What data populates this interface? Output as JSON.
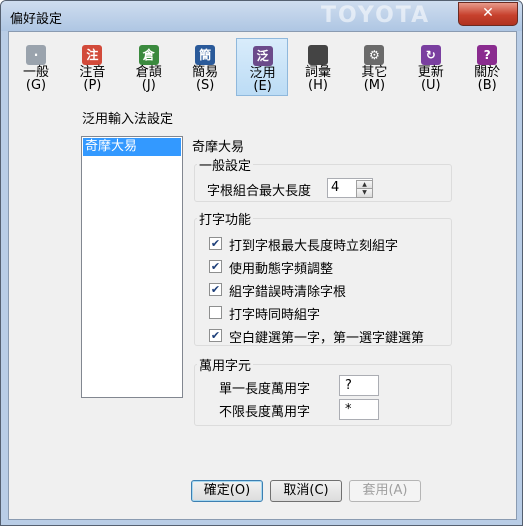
{
  "window": {
    "title": "偏好設定",
    "close_glyph": "✕",
    "title_deco": "TOYOTA"
  },
  "toolbar": {
    "items": [
      {
        "label": "一般",
        "key": "(G)",
        "icon": "general-icon",
        "glyph": "·",
        "color": "#9aa3ad"
      },
      {
        "label": "注音",
        "key": "(P)",
        "icon": "zhuyin-icon",
        "glyph": "注",
        "color": "#d24a3a"
      },
      {
        "label": "倉頡",
        "key": "(J)",
        "icon": "cangjie-icon",
        "glyph": "倉",
        "color": "#3b8a3e"
      },
      {
        "label": "簡易",
        "key": "(S)",
        "icon": "simplex-icon",
        "glyph": "簡",
        "color": "#2a5a9a"
      },
      {
        "label": "泛用",
        "key": "(E)",
        "icon": "generic-icon",
        "glyph": "泛",
        "color": "#6b4a8a"
      },
      {
        "label": "詞彙",
        "key": "(H)",
        "icon": "database-icon",
        "glyph": "",
        "color": "#444444"
      },
      {
        "label": "其它",
        "key": "(M)",
        "icon": "gear-icon",
        "glyph": "⚙",
        "color": "#6a6a6a"
      },
      {
        "label": "更新",
        "key": "(U)",
        "icon": "update-icon",
        "glyph": "↻",
        "color": "#7a3fa0"
      },
      {
        "label": "關於",
        "key": "(B)",
        "icon": "about-icon",
        "glyph": "?",
        "color": "#8a2c8f"
      }
    ],
    "active_index": 4
  },
  "main": {
    "section_title": "泛用輸入法設定",
    "im_list": [
      "奇摩大易"
    ],
    "selected_im": "奇摩大易",
    "general": {
      "title": "一般設定",
      "max_len_label": "字根組合最大長度",
      "max_len_value": "4"
    },
    "typing": {
      "title": "打字功能",
      "options": [
        {
          "label": "打到字根最大長度時立刻組字",
          "checked": true
        },
        {
          "label": "使用動態字頻調整",
          "checked": true
        },
        {
          "label": "組字錯誤時清除字根",
          "checked": true
        },
        {
          "label": "打字時同時組字",
          "checked": false
        },
        {
          "label": "空白鍵選第一字，第一選字鍵選第",
          "checked": true
        }
      ]
    },
    "wildcard": {
      "title": "萬用字元",
      "single_label": "單一長度萬用字",
      "single_value": "?",
      "unlimited_label": "不限長度萬用字",
      "unlimited_value": "*"
    }
  },
  "buttons": {
    "ok": "確定(O)",
    "cancel": "取消(C)",
    "apply": "套用(A)"
  }
}
